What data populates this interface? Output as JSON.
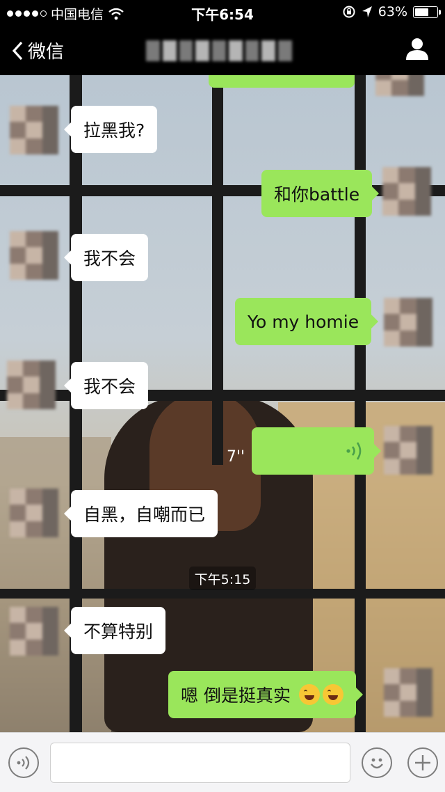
{
  "status_bar": {
    "carrier": "中国电信",
    "time": "下午6:54",
    "battery": "63%",
    "battery_level": 0.63
  },
  "nav": {
    "back_label": "微信",
    "title": ""
  },
  "chat": {
    "messages": [
      {
        "side": "in",
        "text": "拉黑我?"
      },
      {
        "side": "out",
        "text": "和你battle"
      },
      {
        "side": "in",
        "text": "我不会"
      },
      {
        "side": "out",
        "text": "Yo my homie"
      },
      {
        "side": "in",
        "text": "我不会"
      },
      {
        "side": "out",
        "type": "voice",
        "duration": "7''"
      },
      {
        "side": "in",
        "text": "自黑，自嘲而已"
      },
      {
        "side": "in",
        "text": "不算特别"
      },
      {
        "side": "out",
        "text": "嗯 倒是挺真实"
      }
    ],
    "timestamp": "下午5:15",
    "last_message_emoji": [
      "face-with-tears-of-joy-icon",
      "face-with-tears-of-joy-icon"
    ]
  },
  "input": {
    "value": "",
    "placeholder": ""
  },
  "colors": {
    "outgoing_bubble": "#9ae65b",
    "incoming_bubble": "#ffffff",
    "bar_background": "#000000",
    "input_bar": "#f4f4f6"
  }
}
